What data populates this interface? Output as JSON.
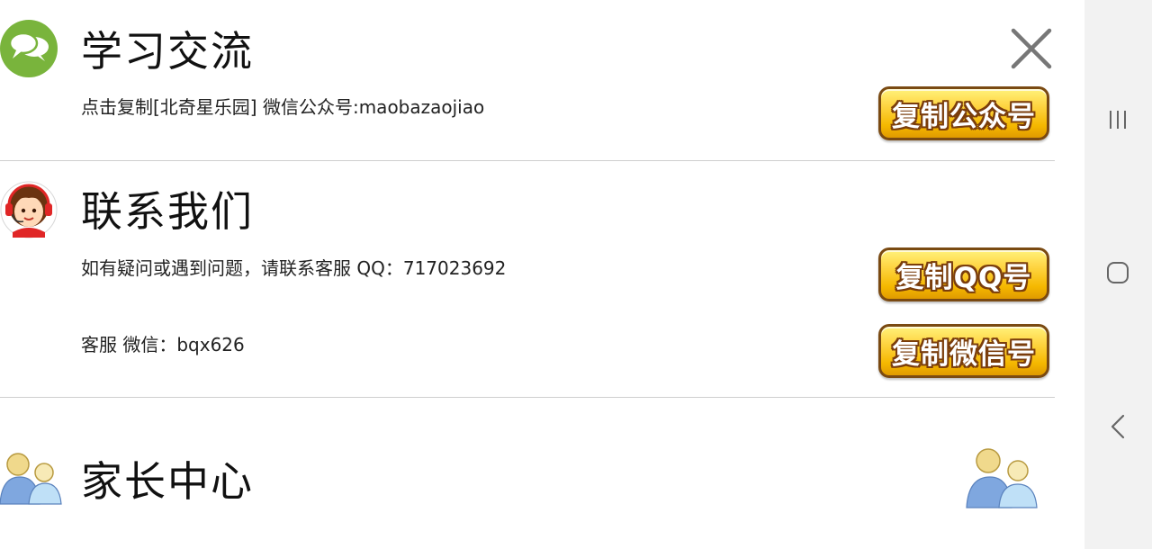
{
  "study": {
    "title": "学习交流",
    "info": "点击复制[北奇星乐园] 微信公众号:maobazaojiao",
    "copy_button": "复制公众号"
  },
  "contact": {
    "title": "联系我们",
    "qq_info": "如有疑问或遇到问题，请联系客服 QQ：717023692",
    "copy_qq_button": "复制QQ号",
    "wechat_info": "客服 微信：bqx626",
    "copy_wechat_button": "复制微信号"
  },
  "parent": {
    "title": "家长中心"
  },
  "icons": {
    "study": "chat-bubbles-icon",
    "contact": "customer-service-icon",
    "parent": "parents-icon",
    "close": "close-icon",
    "nav_recents": "recents-icon",
    "nav_home": "home-icon",
    "nav_back": "back-icon"
  },
  "colors": {
    "button_gold": "#f5b800",
    "button_border": "#7a4a12",
    "chat_icon_green": "#79b43c",
    "navbar_bg": "#f2f2f2"
  }
}
